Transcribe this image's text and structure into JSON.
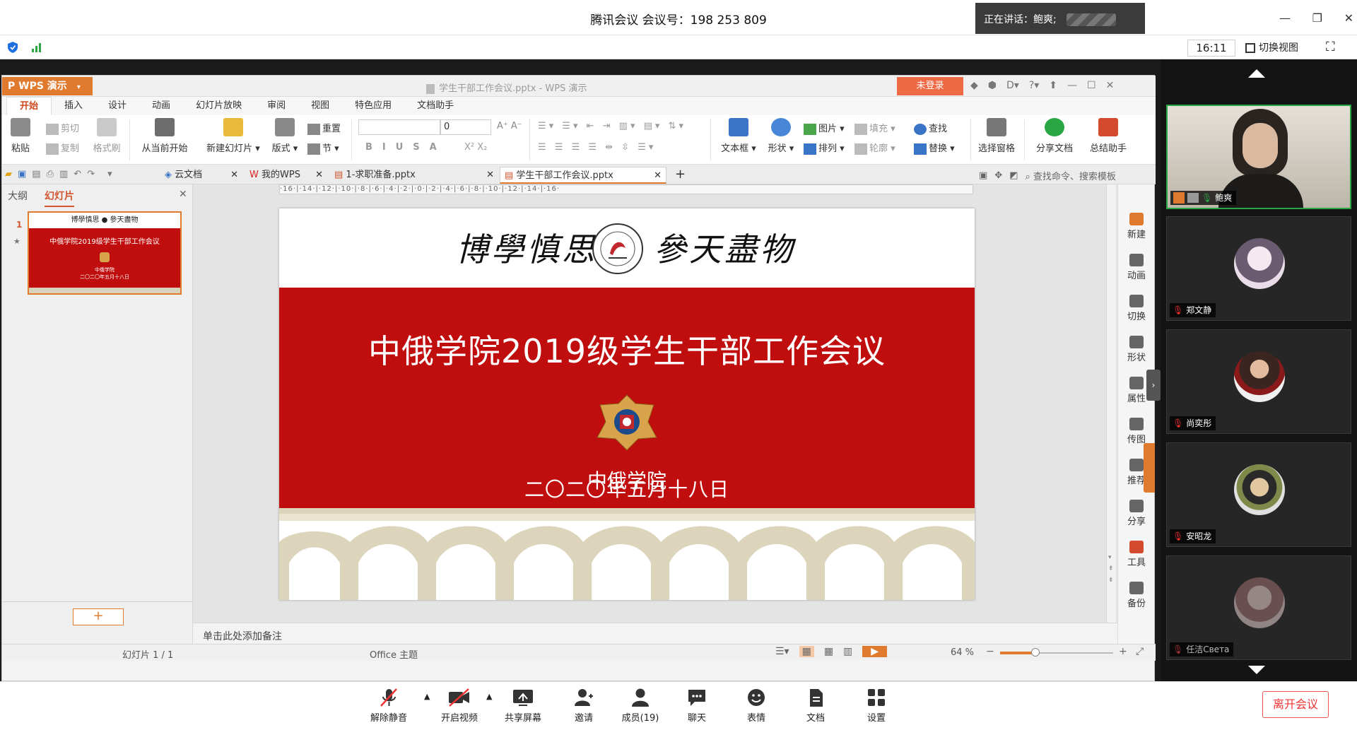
{
  "meeting": {
    "title": "腾讯会议 会议号：198 253 809",
    "speaking_label": "正在讲话：鲍爽;",
    "clock": "16:11",
    "switch_view_label": "切换视图"
  },
  "wps": {
    "brand": "WPS 演示",
    "window_title": "学生干部工作会议.pptx - WPS 演示",
    "login_label": "未登录",
    "menu": [
      "开始",
      "插入",
      "设计",
      "动画",
      "幻灯片放映",
      "审阅",
      "视图",
      "特色应用",
      "文档助手"
    ],
    "ribbon": {
      "paste": "粘贴",
      "cut": "剪切",
      "copy": "复制",
      "format_painter": "格式刷",
      "from_current": "从当前开始",
      "new_slide": "新建幻灯片",
      "layout": "版式",
      "reset": "重置",
      "section": "节",
      "font_size": "0",
      "textbox": "文本框",
      "shape": "形状",
      "picture": "图片",
      "fill": "填充",
      "find": "查找",
      "arrange": "排列",
      "outline": "轮廓",
      "replace": "替换",
      "select_pane": "选择窗格",
      "share_doc": "分享文档",
      "summary_helper": "总结助手"
    },
    "tabs": [
      "云文档",
      "我的WPS",
      "1-求职准备.pptx",
      "学生干部工作会议.pptx"
    ],
    "search_hint": "查找命令、搜索模板",
    "left_tabs": [
      "大纲",
      "幻灯片"
    ],
    "slide_number": "1",
    "thumb": {
      "title": "中俄学院2019级学生干部工作会议",
      "subtitle": "中俄学院",
      "date": "二〇二〇年五月十八日"
    },
    "ruler": "·16·|·14·|·12·|·10·|·8·|·6·|·4·|·2·|·0·|·2·|·4·|·6·|·8·|·10·|·12·|·14·|·16·",
    "slide": {
      "motto_left": "博學慎思",
      "motto_right": "參天盡物",
      "title": "中俄学院2019级学生干部工作会议",
      "org": "中俄学院",
      "date": "二〇二〇年五月十八日"
    },
    "notes_hint": "单击此处添加备注",
    "sidebar": [
      "新建",
      "动画",
      "切换",
      "形状",
      "属性",
      "传图",
      "推荐",
      "分享",
      "工具",
      "备份"
    ],
    "status": {
      "slide_count": "幻灯片 1 / 1",
      "theme": "Office 主题",
      "zoom": "64 %"
    }
  },
  "participants": [
    {
      "name": "鲍爽"
    },
    {
      "name": "郑文静"
    },
    {
      "name": "尚奕彤"
    },
    {
      "name": "安昭龙"
    },
    {
      "name": "任洁Света"
    }
  ],
  "bottombar": {
    "buttons": [
      "解除静音",
      "开启视频",
      "共享屏幕",
      "邀请",
      "成员(19)",
      "聊天",
      "表情",
      "文档",
      "设置"
    ],
    "leave": "离开会议"
  },
  "colors": {
    "slide_red": "#c00d0d",
    "wps_orange": "#e07a2e",
    "tencent_blue": "#1e6fe0"
  }
}
